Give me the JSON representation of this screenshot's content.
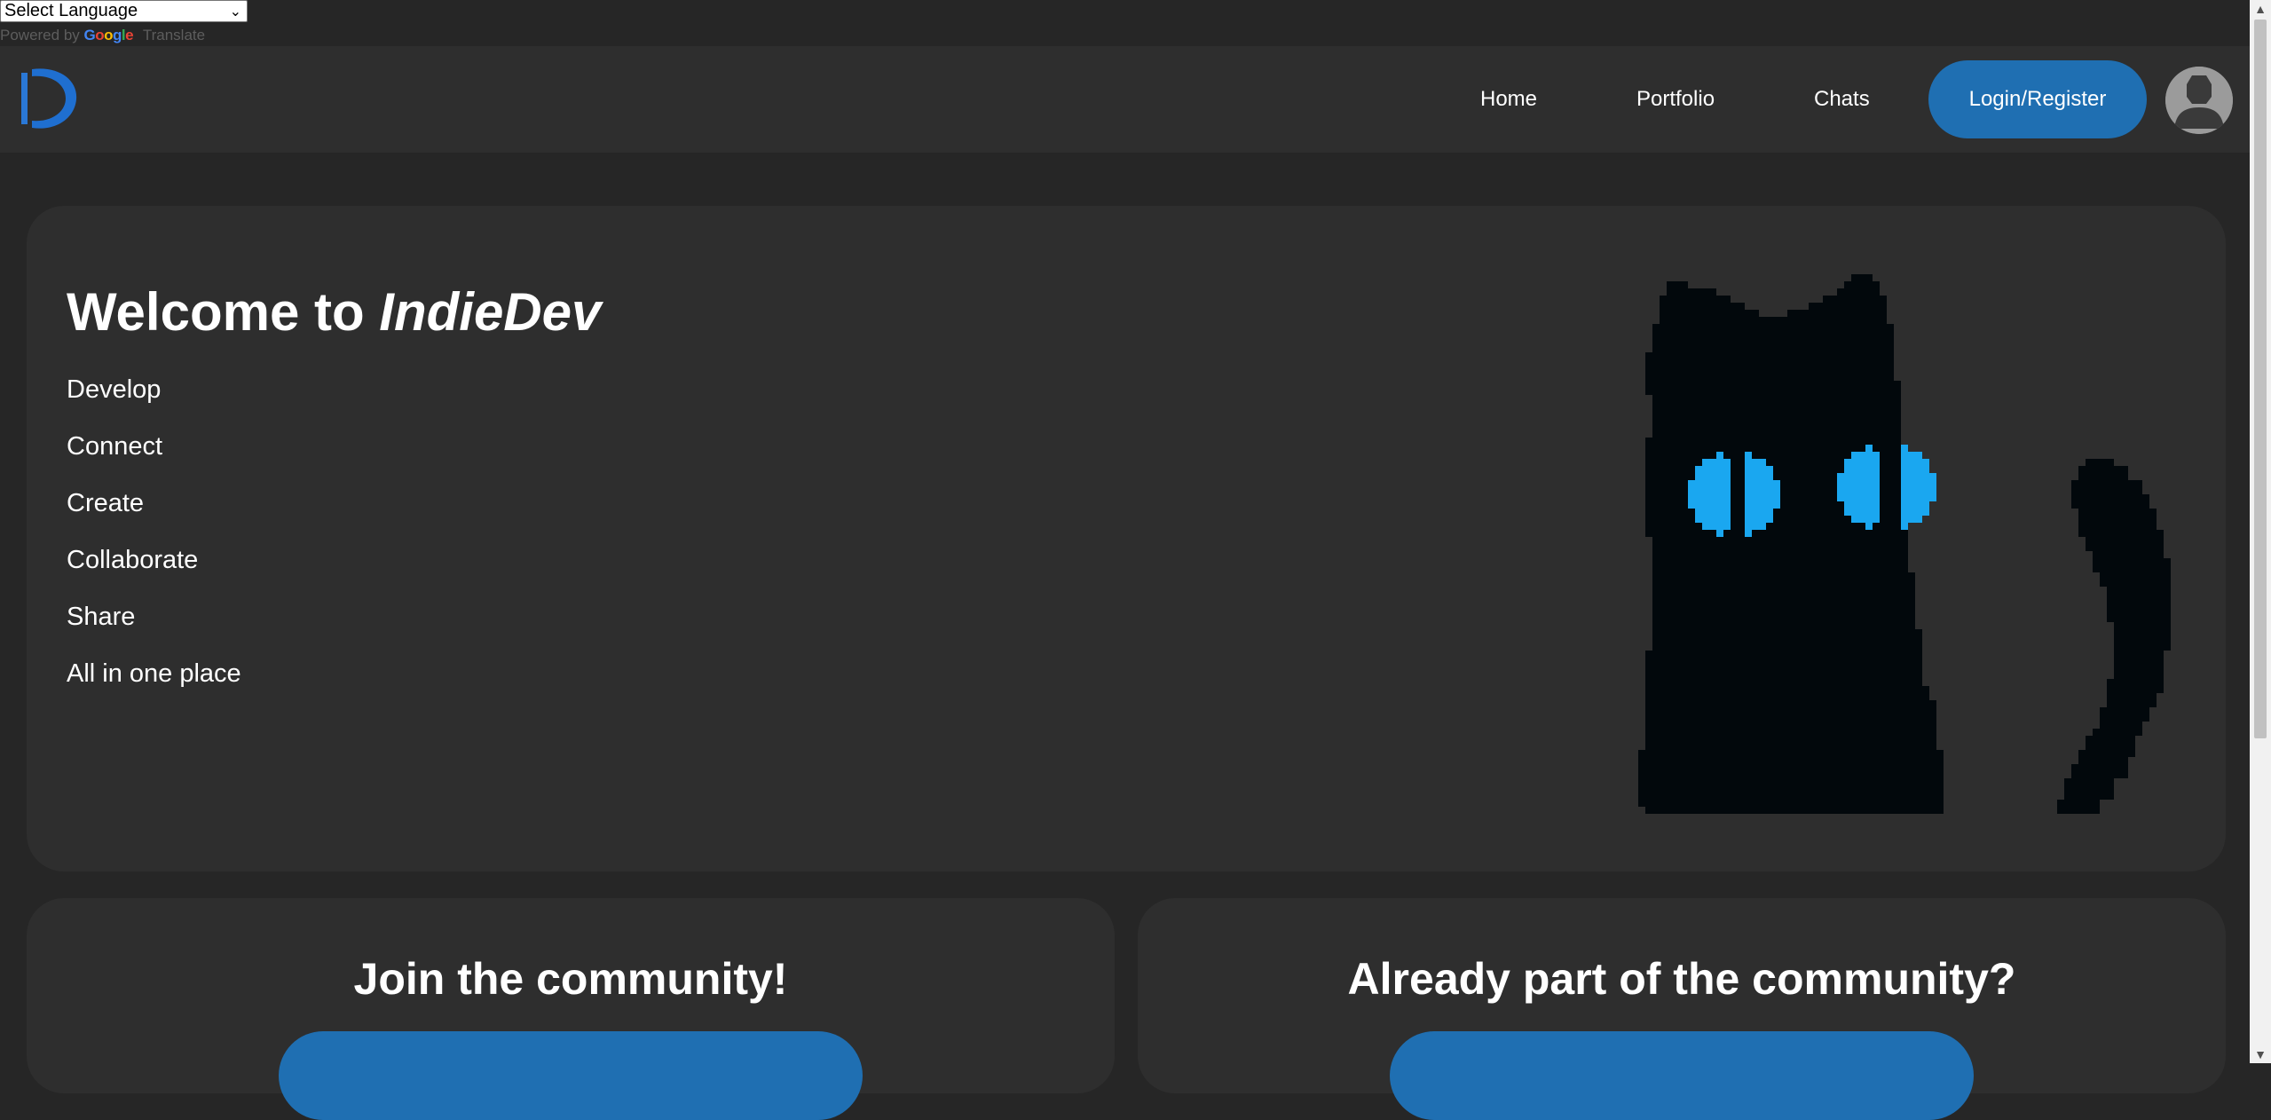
{
  "translate": {
    "select_label": "Select Language",
    "powered_prefix": "Powered by",
    "google_letters": [
      "G",
      "o",
      "o",
      "g",
      "l",
      "e"
    ],
    "translate_word": "Translate"
  },
  "nav": {
    "links": [
      "Home",
      "Portfolio",
      "Chats"
    ],
    "login_label": "Login/Register"
  },
  "hero": {
    "title_prefix": "Welcome to ",
    "title_brand": "IndieDev",
    "lines": [
      "Develop",
      "Connect",
      "Create",
      "Collaborate",
      "Share",
      "All in one place"
    ]
  },
  "cards": {
    "join_title": "Join the community!",
    "already_title": "Already part of the community?"
  },
  "colors": {
    "accent": "#1f6fb2",
    "background": "#262626",
    "surface": "#2e2e2e",
    "cat_eye": "#1aa7f0"
  }
}
